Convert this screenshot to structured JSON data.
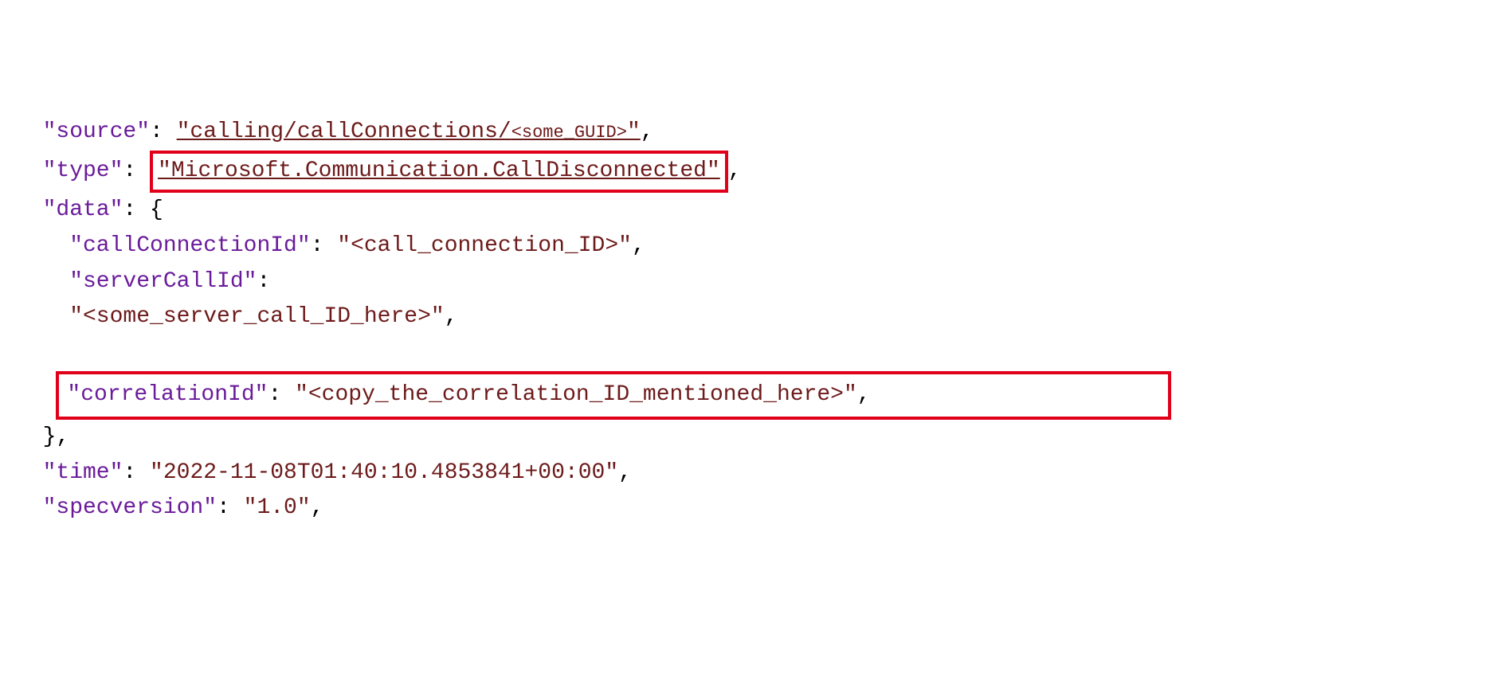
{
  "code": {
    "source_key": "\"source\"",
    "source_val_prefix": "\"calling/callConnections/",
    "source_val_ph": "<some_GUID>",
    "source_val_suffix": "\"",
    "type_key": "\"type\"",
    "type_val": "\"Microsoft.Communication.CallDisconnected\"",
    "data_key": "\"data\"",
    "callConnectionId_key": "\"callConnectionId\"",
    "callConnectionId_val": "\"<call_connection_ID>\"",
    "serverCallId_key": "\"serverCallId\"",
    "serverCallId_val": "\"<some_server_call_ID_here>\"",
    "correlationId_key": "\"correlationId\"",
    "correlationId_val": "\"<copy_the_correlation_ID_mentioned_here>\"",
    "time_key": "\"time\"",
    "time_val": "\"2022-11-08T01:40:10.4853841+00:00\"",
    "specversion_key": "\"specversion\"",
    "specversion_val": "\"1.0\"",
    "colon": ":",
    "colon_sp": ": ",
    "comma": ",",
    "brace_open": "{",
    "brace_close": "}",
    "space": " "
  }
}
